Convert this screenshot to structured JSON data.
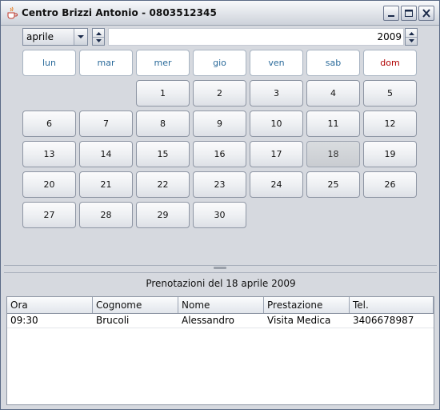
{
  "window": {
    "title": "Centro Brizzi Antonio - 0803512345"
  },
  "icons": {
    "app": "java-cup-icon",
    "minimize": "minimize-icon",
    "maximize": "maximize-icon",
    "close": "close-icon"
  },
  "calendar": {
    "month": "aprile",
    "year": "2009",
    "weekdays": [
      "lun",
      "mar",
      "mer",
      "gio",
      "ven",
      "sab",
      "dom"
    ],
    "days": [
      "1",
      "2",
      "3",
      "4",
      "5",
      "6",
      "7",
      "8",
      "9",
      "10",
      "11",
      "12",
      "13",
      "14",
      "15",
      "16",
      "17",
      "18",
      "19",
      "20",
      "21",
      "22",
      "23",
      "24",
      "25",
      "26",
      "27",
      "28",
      "29",
      "30"
    ],
    "first_weekday_index": 2,
    "selected_day": "18",
    "sunday_color": "#b00000",
    "weekday_color": "#2a6a9a"
  },
  "bookings": {
    "title": "Prenotazioni del 18 aprile 2009",
    "columns": [
      "Ora",
      "Cognome",
      "Nome",
      "Prestazione",
      "Tel."
    ],
    "rows": [
      [
        "09:30",
        "Brucoli",
        "Alessandro",
        "Visita Medica",
        "3406678987"
      ]
    ]
  }
}
